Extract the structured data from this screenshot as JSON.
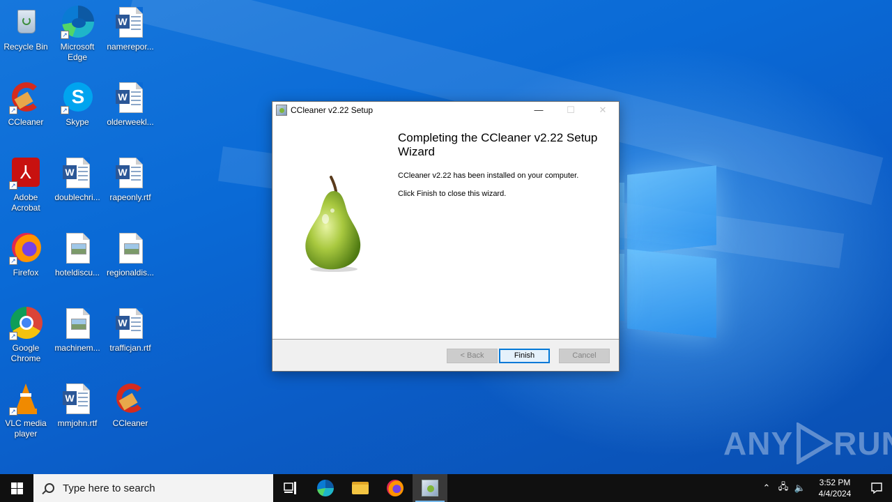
{
  "desktop": {
    "icons": [
      {
        "label": "Recycle Bin",
        "kind": "recycle-bin"
      },
      {
        "label": "Microsoft Edge",
        "kind": "edge"
      },
      {
        "label": "namerepor...",
        "kind": "word"
      },
      {
        "label": "CCleaner",
        "kind": "ccleaner"
      },
      {
        "label": "Skype",
        "kind": "skype"
      },
      {
        "label": "olderweekl...",
        "kind": "word"
      },
      {
        "label": "Adobe Acrobat",
        "kind": "acrobat"
      },
      {
        "label": "doublechri...",
        "kind": "word"
      },
      {
        "label": "rapeonly.rtf",
        "kind": "word"
      },
      {
        "label": "Firefox",
        "kind": "firefox"
      },
      {
        "label": "hoteldiscu...",
        "kind": "image"
      },
      {
        "label": "regionaldis...",
        "kind": "image"
      },
      {
        "label": "Google Chrome",
        "kind": "chrome"
      },
      {
        "label": "machinem...",
        "kind": "image"
      },
      {
        "label": "trafficjan.rtf",
        "kind": "word"
      },
      {
        "label": "VLC media player",
        "kind": "vlc"
      },
      {
        "label": "mmjohn.rtf",
        "kind": "word"
      },
      {
        "label": "CCleaner",
        "kind": "ccleaner"
      }
    ]
  },
  "dialog": {
    "title": "CCleaner v2.22 Setup",
    "heading": "Completing the CCleaner v2.22 Setup Wizard",
    "message_installed": "CCleaner v2.22 has been installed on your computer.",
    "message_close": "Click Finish to close this wizard.",
    "buttons": {
      "back": "< Back",
      "finish": "Finish",
      "cancel": "Cancel"
    },
    "titlebar_buttons": {
      "minimize": "—",
      "maximize": "☐",
      "close": "✕"
    }
  },
  "taskbar": {
    "search_placeholder": "Type here to search",
    "clock_time": "3:52 PM",
    "clock_date": "4/4/2024"
  },
  "watermark": {
    "text_left": "ANY",
    "text_right": "RUN"
  }
}
